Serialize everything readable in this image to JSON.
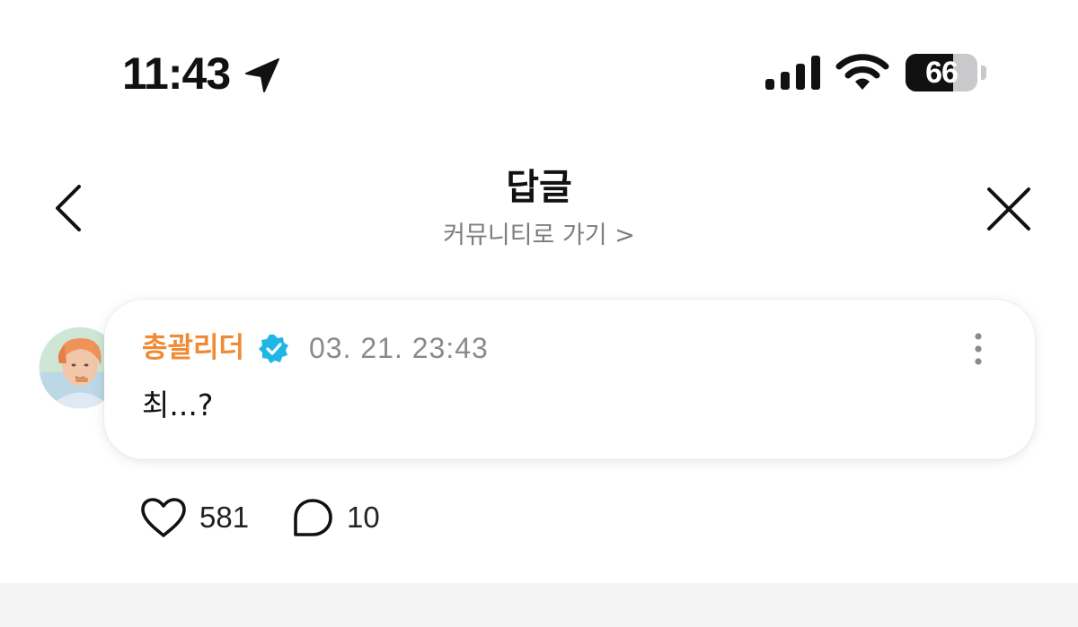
{
  "status_bar": {
    "time": "11:43",
    "battery_level": "66",
    "battery_fraction": 0.66,
    "icons": [
      "location-arrow-icon",
      "cellular-signal-icon",
      "wifi-icon",
      "battery-icon"
    ]
  },
  "header": {
    "title": "답글",
    "community_link": "커뮤니티로 가기 >",
    "back_icon": "chevron-left-icon",
    "close_icon": "close-icon"
  },
  "comment": {
    "author": "총괄리더",
    "verified": true,
    "timestamp": "03. 21. 23:43",
    "text": "최...?",
    "more_icon": "more-vertical-icon"
  },
  "actions": {
    "likes": "581",
    "replies": "10",
    "like_icon": "heart-icon",
    "reply_icon": "comment-bubble-icon"
  },
  "colors": {
    "author_name": "#f08a34",
    "verified_badge": "#1fb6e6",
    "secondary_text": "#8a8a8a",
    "divider": "#f4f4f5"
  }
}
